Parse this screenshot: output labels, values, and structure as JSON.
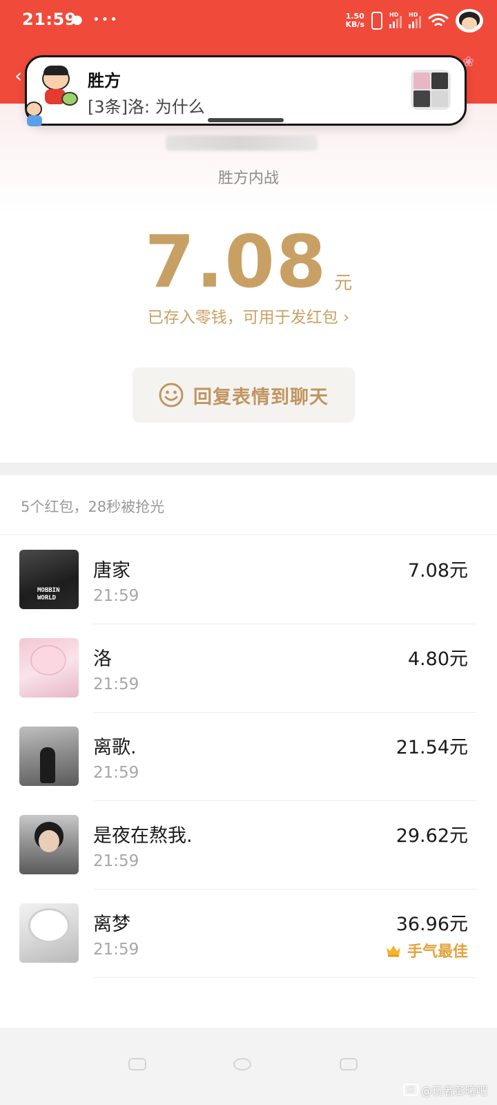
{
  "status_bar": {
    "time": "21:59",
    "net_speed_value": "1.50",
    "net_speed_unit": "KB/s",
    "hd_label": "HD",
    "more_icon": "more-dots-icon"
  },
  "notification": {
    "title": "胜方",
    "message": "[3条]洛: 为什么"
  },
  "header": {
    "group_name": "胜方内战"
  },
  "amount": {
    "value": "7.08",
    "unit": "元",
    "stored_text": "已存入零钱，可用于发红包",
    "stored_chevron": "›"
  },
  "reply_button": {
    "label": "回复表情到聊天",
    "icon": "smiley-icon"
  },
  "list": {
    "summary": "5个红包，28秒被抢光",
    "items": [
      {
        "name": "唐家",
        "time": "21:59",
        "amount": "7.08元",
        "avatar_tag": "MOBBIN WORLD"
      },
      {
        "name": "洛",
        "time": "21:59",
        "amount": "4.80元"
      },
      {
        "name": "离歌.",
        "time": "21:59",
        "amount": "21.54元"
      },
      {
        "name": "是夜在熬我.",
        "time": "21:59",
        "amount": "29.62元"
      },
      {
        "name": "离梦",
        "time": "21:59",
        "amount": "36.96元",
        "badge": "手气最佳"
      }
    ]
  },
  "watermark": {
    "text": "@玩者彭曦吧"
  },
  "colors": {
    "header_red": "#f04a3a",
    "gold": "#c9a064",
    "best_orange": "#e2a23a"
  }
}
